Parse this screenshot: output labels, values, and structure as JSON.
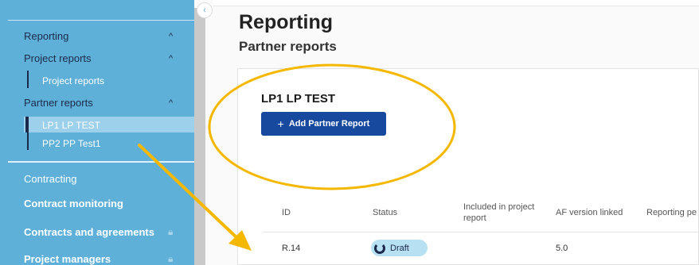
{
  "sidebar": {
    "items": [
      {
        "label": "Reporting"
      },
      {
        "label": "Project reports"
      },
      {
        "label": "Project reports"
      },
      {
        "label": "Partner reports"
      },
      {
        "label": "LP1 LP TEST"
      },
      {
        "label": "PP2 PP Test1"
      },
      {
        "label": "Contracting"
      },
      {
        "label": "Contract monitoring"
      },
      {
        "label": "Contracts and agreements"
      },
      {
        "label": "Project managers"
      }
    ],
    "chevron": "^",
    "collapse_icon": "‹"
  },
  "main": {
    "title": "Reporting",
    "subtitle": "Partner reports",
    "card": {
      "title": "LP1 LP TEST",
      "add_button": "Add Partner Report",
      "plus": "+"
    },
    "table": {
      "headers": [
        "ID",
        "Status",
        "Included in project report",
        "AF version linked",
        "Reporting pe"
      ],
      "rows": [
        {
          "id": "R.14",
          "status": "Draft",
          "included": "",
          "af_version": "5.0"
        }
      ]
    }
  },
  "colors": {
    "sidebar": "#5fb0d9",
    "primary_button": "#174a9e",
    "annotation": "#f5b800",
    "badge": "#b7e0f2"
  }
}
